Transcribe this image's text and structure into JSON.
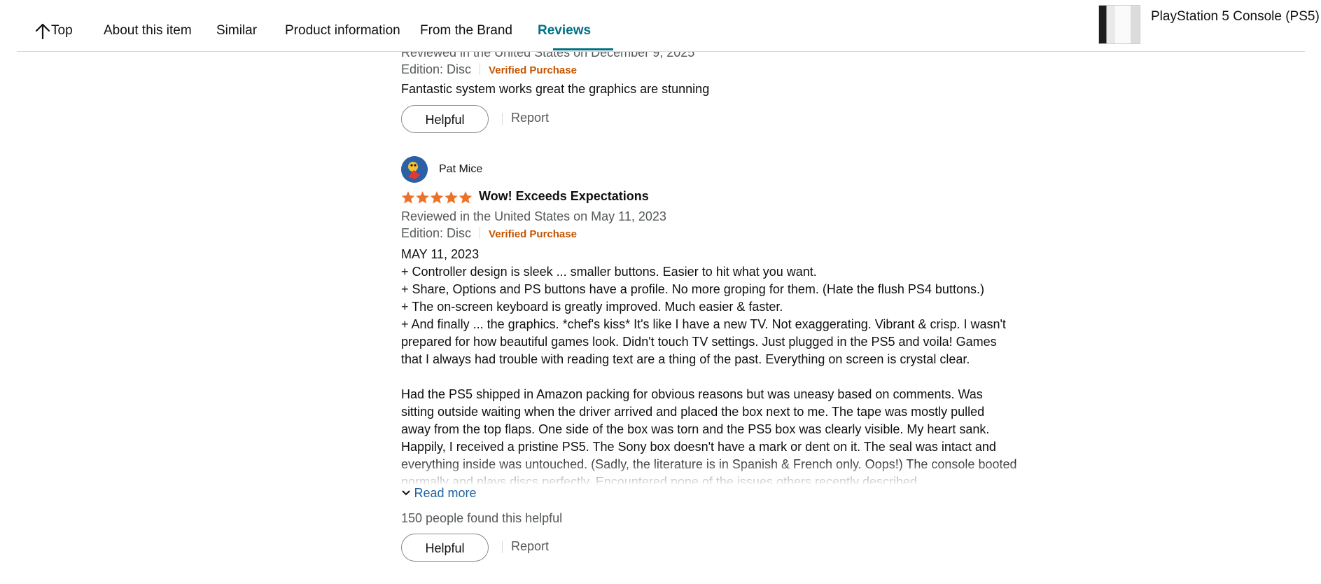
{
  "nav": {
    "top_label": "Top",
    "items": [
      "About this item",
      "Similar",
      "Product information",
      "From the Brand",
      "Reviews"
    ],
    "active": "Reviews"
  },
  "product": {
    "title": "PlayStation 5 Console (PS5)"
  },
  "colors": {
    "accent_teal": "#007185",
    "verified_orange": "#c45500",
    "star_orange": "#ec7227",
    "link_blue": "#2162a1"
  },
  "reviews": [
    {
      "reviewed_line": "Reviewed in the United States on December 9, 2025",
      "edition": "Edition: Disc",
      "verified": "Verified Purchase",
      "body": "Fantastic system works great the graphics are stunning",
      "helpful_button": "Helpful",
      "report": "Report"
    },
    {
      "reviewer": "Pat Mice",
      "rating": 5,
      "title": "Wow! Exceeds Expectations",
      "reviewed_line": "Reviewed in the United States on May 11, 2023",
      "edition": "Edition: Disc",
      "verified": "Verified Purchase",
      "body_lines": [
        "MAY 11, 2023",
        "+ Controller design is sleek ... smaller buttons. Easier to hit what you want.",
        "+ Share, Options and PS buttons have a profile. No more groping for them. (Hate the flush PS4 buttons.)",
        "+ The on-screen keyboard is greatly improved. Much easier & faster.",
        "+ And finally ... the graphics. *chef's kiss* It's like I have a new TV. Not exaggerating. Vibrant & crisp. I wasn't prepared for how beautiful games look. Didn't touch TV settings. Just plugged in the PS5 and voila! Games that I always had trouble with reading text are a thing of the past. Everything on screen is crystal clear.",
        "",
        "Had the PS5 shipped in Amazon packing for obvious reasons but was uneasy based on comments. Was sitting outside waiting when the driver arrived and placed the box next to me. The tape was mostly pulled away from the top flaps. One side of the box was torn and the PS5 box was clearly visible. My heart sank. Happily, I received a pristine PS5. The Sony box doesn't have a mark or dent on it. The seal was intact and everything inside was untouched. (Sadly, the literature is in Spanish & French only. Oops!) The console booted normally and plays discs perfectly. Encountered none of the issues others recently described."
      ],
      "read_more": "Read more",
      "helpful_count": "150 people found this helpful",
      "helpful_button": "Helpful",
      "report": "Report"
    }
  ]
}
